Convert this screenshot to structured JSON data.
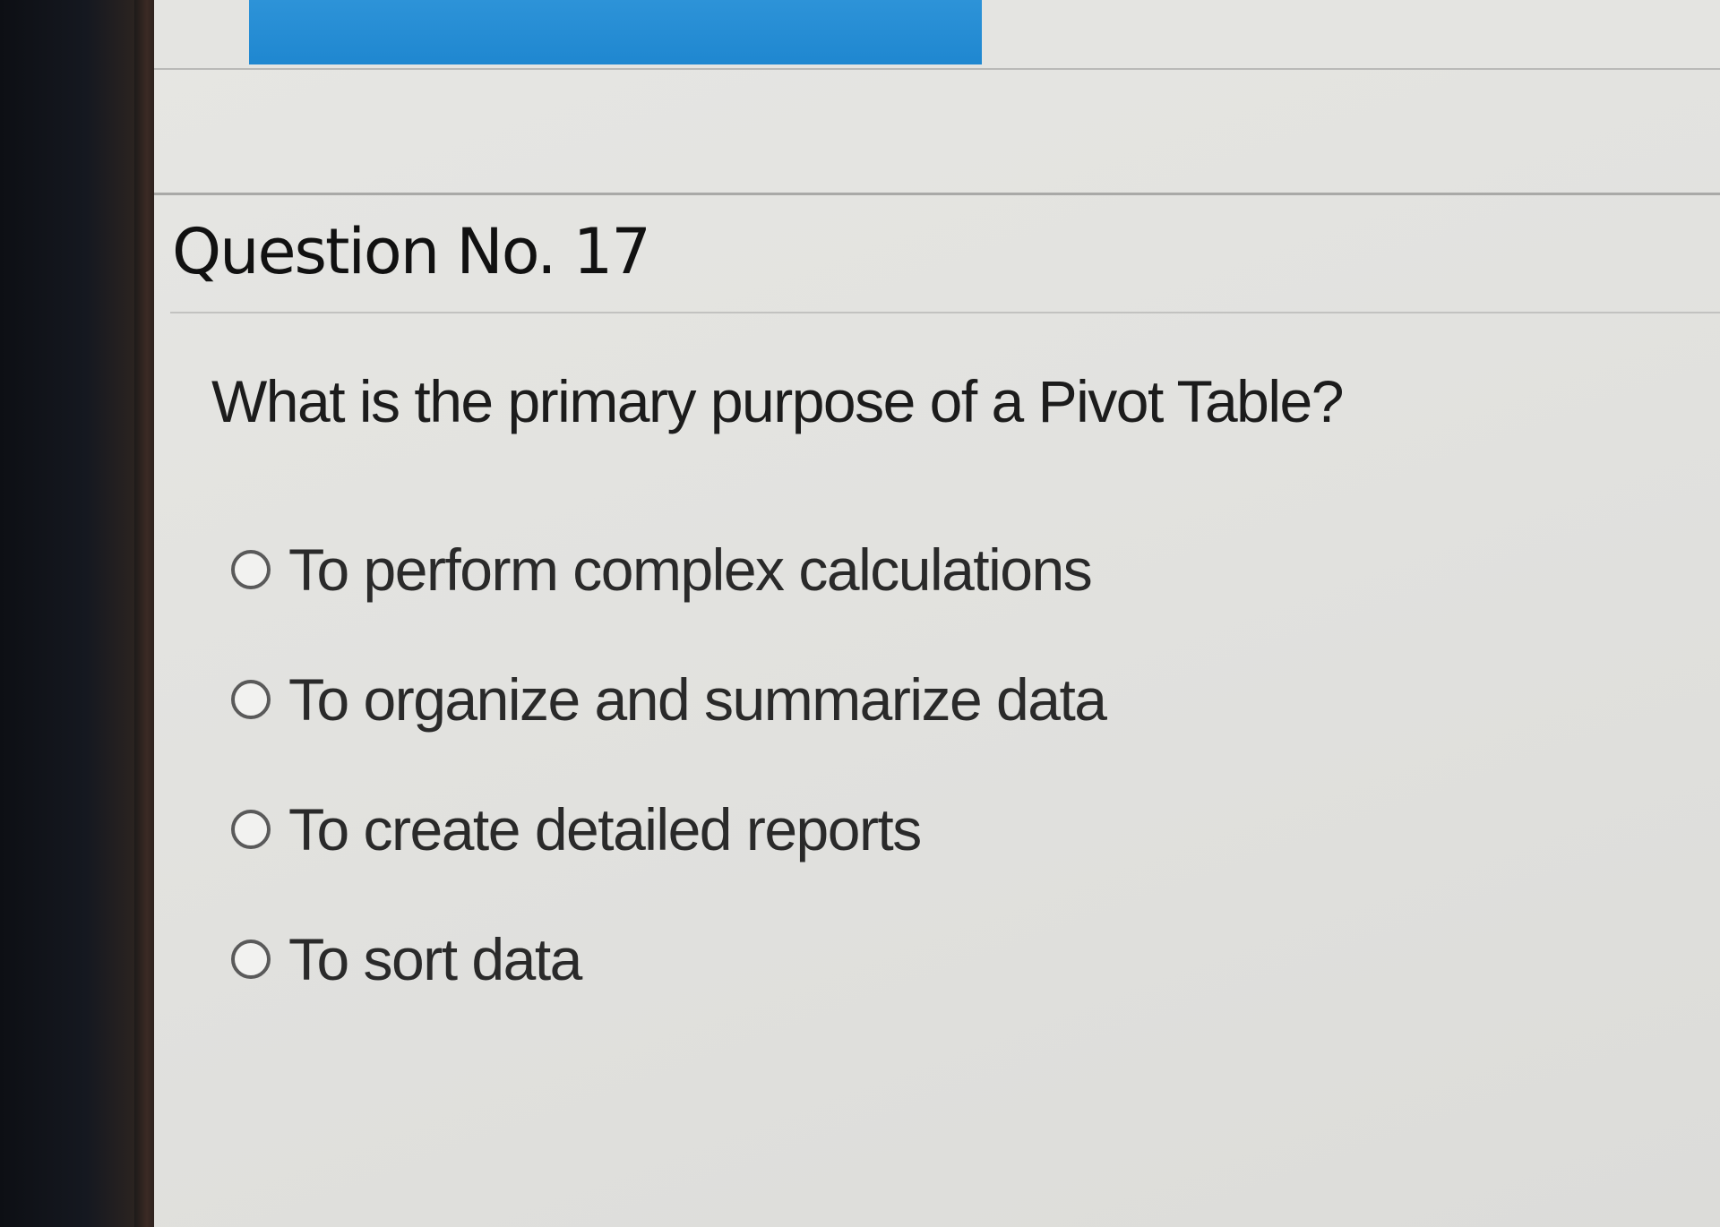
{
  "colors": {
    "banner": "#2089d2",
    "background": "#e4e4e1",
    "text": "#1c1c1c"
  },
  "quiz": {
    "question_number": "Question No. 17",
    "question_text": "What is the primary purpose of a Pivot Table?",
    "options": [
      {
        "label": "To perform complex calculations"
      },
      {
        "label": "To organize and summarize data"
      },
      {
        "label": "To create detailed reports"
      },
      {
        "label": "To sort data"
      }
    ]
  }
}
